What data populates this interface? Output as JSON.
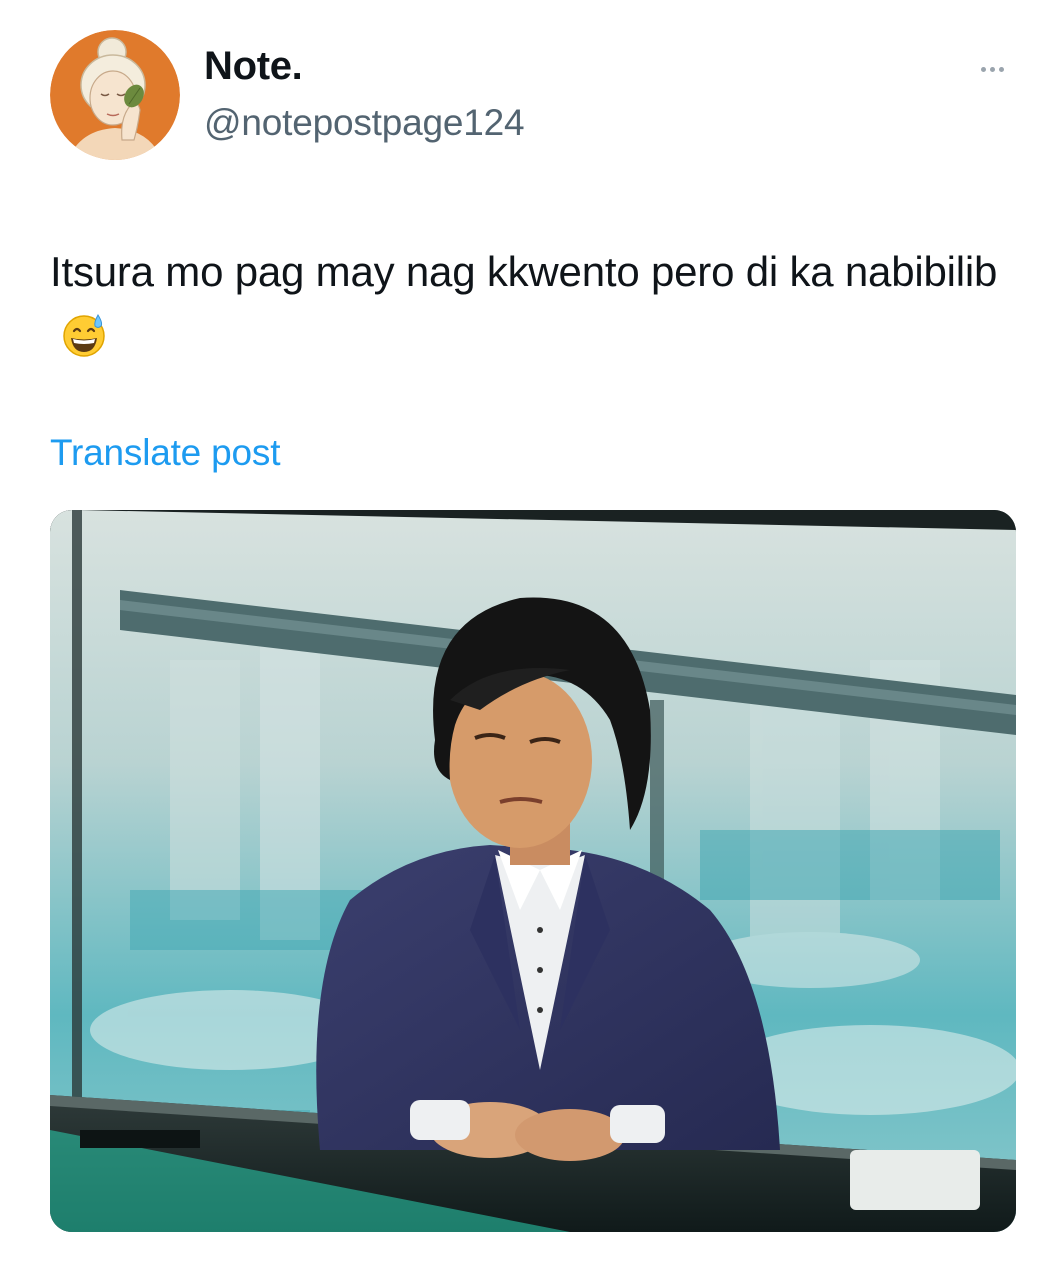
{
  "author": {
    "display_name": "Note.",
    "handle": "@notepostpage124",
    "avatar_icon": "avatar-illustration-icon"
  },
  "menu": {
    "icon": "more-horizontal-icon"
  },
  "post": {
    "text": "Itsura mo pag may nag kkwento pero di ka nabibilib",
    "emoji": "grinning-face-with-sweat-emoji",
    "translate_label": "Translate post"
  },
  "colors": {
    "link": "#1d9bf0",
    "handle": "#536471",
    "text": "#0f1419",
    "avatar_bg": "#e07a2c"
  }
}
